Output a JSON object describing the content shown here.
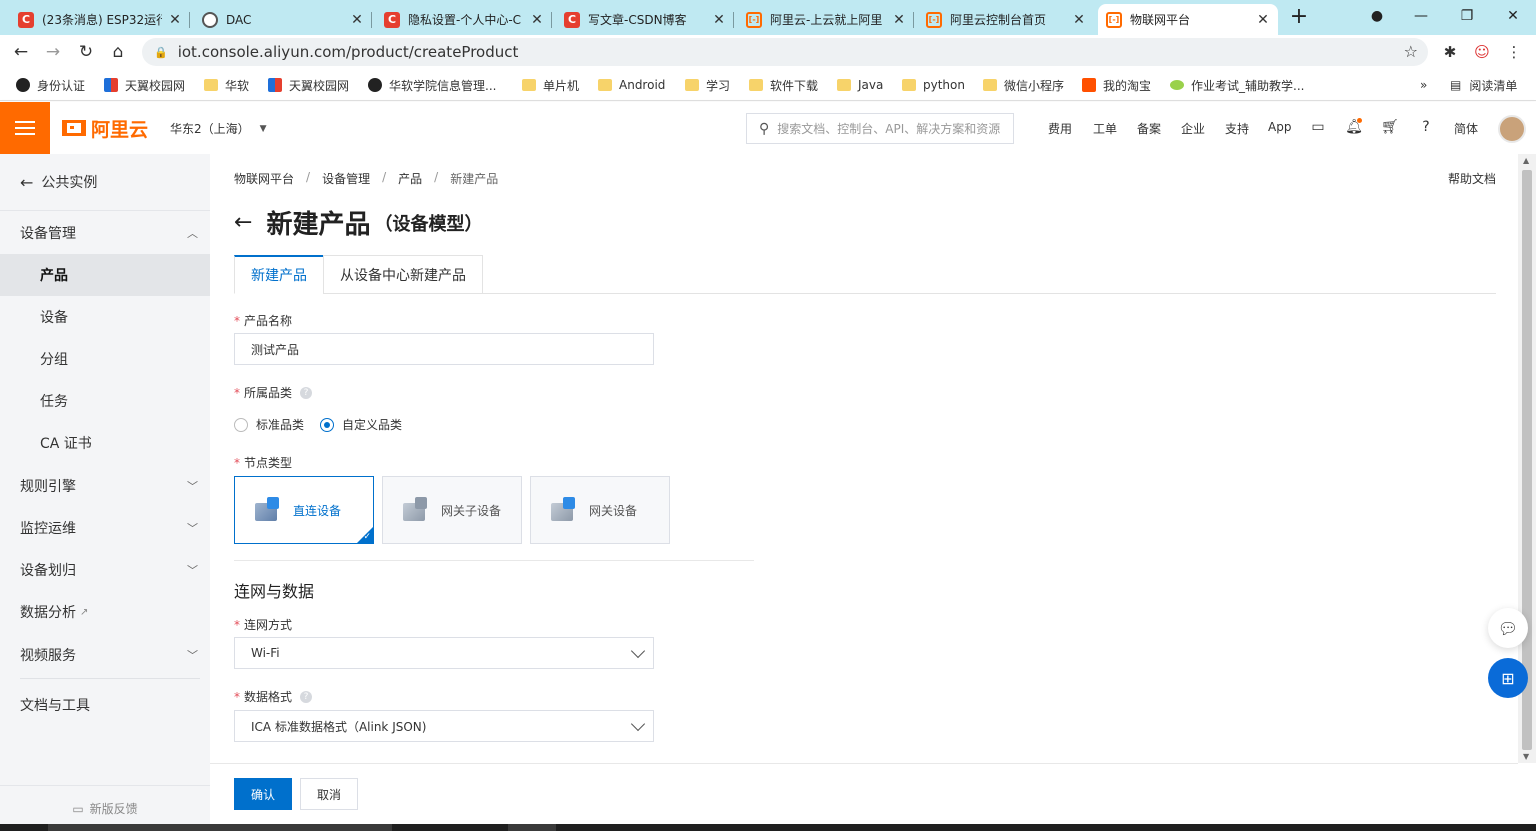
{
  "browser": {
    "tabs": [
      {
        "title": "(23条消息) ESP32运行",
        "icon": "csdn-icon"
      },
      {
        "title": "DAC",
        "icon": "globe-icon"
      },
      {
        "title": "隐私设置-个人中心-C",
        "icon": "csdn-icon"
      },
      {
        "title": "写文章-CSDN博客",
        "icon": "csdn-icon"
      },
      {
        "title": "阿里云-上云就上阿里",
        "icon": "aliyun-icon"
      },
      {
        "title": "阿里云控制台首页",
        "icon": "aliyun-icon"
      },
      {
        "title": "物联网平台",
        "icon": "aliyun-icon",
        "active": true
      }
    ],
    "new_tab": "+",
    "url": "iot.console.aliyun.com/product/createProduct",
    "bookmarks": [
      {
        "label": "身份认证",
        "icon": "globe"
      },
      {
        "label": "天翼校园网",
        "icon": "tianyi"
      },
      {
        "label": "华软",
        "icon": "folder"
      },
      {
        "label": "天翼校园网",
        "icon": "tianyi"
      },
      {
        "label": "华软学院信息管理...",
        "icon": "globe"
      },
      {
        "label": "单片机",
        "icon": "folder"
      },
      {
        "label": "Android",
        "icon": "folder"
      },
      {
        "label": "学习",
        "icon": "folder"
      },
      {
        "label": "软件下载",
        "icon": "folder"
      },
      {
        "label": "Java",
        "icon": "folder"
      },
      {
        "label": "python",
        "icon": "folder"
      },
      {
        "label": "微信小程序",
        "icon": "folder"
      },
      {
        "label": "我的淘宝",
        "icon": "taobao"
      },
      {
        "label": "作业考试_辅助教学...",
        "icon": "spark"
      }
    ],
    "bookmarks_more": "»",
    "reading_list": "阅读清单"
  },
  "topnav": {
    "logo_text": "阿里云",
    "region": "华东2（上海）",
    "search_placeholder": "搜索文档、控制台、API、解决方案和资源",
    "links": [
      "费用",
      "工单",
      "备案",
      "企业",
      "支持",
      "App"
    ],
    "lang": "简体"
  },
  "sidebar": {
    "back_label": "公共实例",
    "groups": [
      {
        "label": "设备管理",
        "expanded": true
      },
      {
        "label": "规则引擎"
      },
      {
        "label": "监控运维"
      },
      {
        "label": "设备划归"
      },
      {
        "label": "数据分析"
      },
      {
        "label": "视频服务"
      }
    ],
    "items": [
      {
        "label": "产品",
        "active": true
      },
      {
        "label": "设备"
      },
      {
        "label": "分组"
      },
      {
        "label": "任务"
      },
      {
        "label": "CA 证书"
      }
    ],
    "docs_tools": "文档与工具",
    "feedback": "新版反馈"
  },
  "main": {
    "breadcrumb": [
      "物联网平台",
      "设备管理",
      "产品",
      "新建产品"
    ],
    "breadcrumb_sep": "/",
    "help_doc": "帮助文档",
    "title": "新建产品",
    "title_suffix": "（设备模型）",
    "tabs": [
      "新建产品",
      "从设备中心新建产品"
    ],
    "form": {
      "required_mark": "*",
      "product_name_label": "产品名称",
      "product_name_value": "测试产品",
      "category_label": "所属品类",
      "category_options": [
        "标准品类",
        "自定义品类"
      ],
      "category_selected": "自定义品类",
      "node_type_label": "节点类型",
      "node_types": [
        "直连设备",
        "网关子设备",
        "网关设备"
      ],
      "node_type_selected": "直连设备",
      "section_title": "连网与数据",
      "network_label": "连网方式",
      "network_value": "Wi-Fi",
      "data_format_label": "数据格式",
      "data_format_value": "ICA 标准数据格式（Alink JSON)"
    }
  },
  "footer": {
    "confirm": "确认",
    "cancel": "取消"
  },
  "colors": {
    "brand_orange": "#ff6a00",
    "primary_blue": "#0070cc",
    "tab_strip": "#bfe9f2",
    "sidebar_bg": "#f4f5f7"
  }
}
